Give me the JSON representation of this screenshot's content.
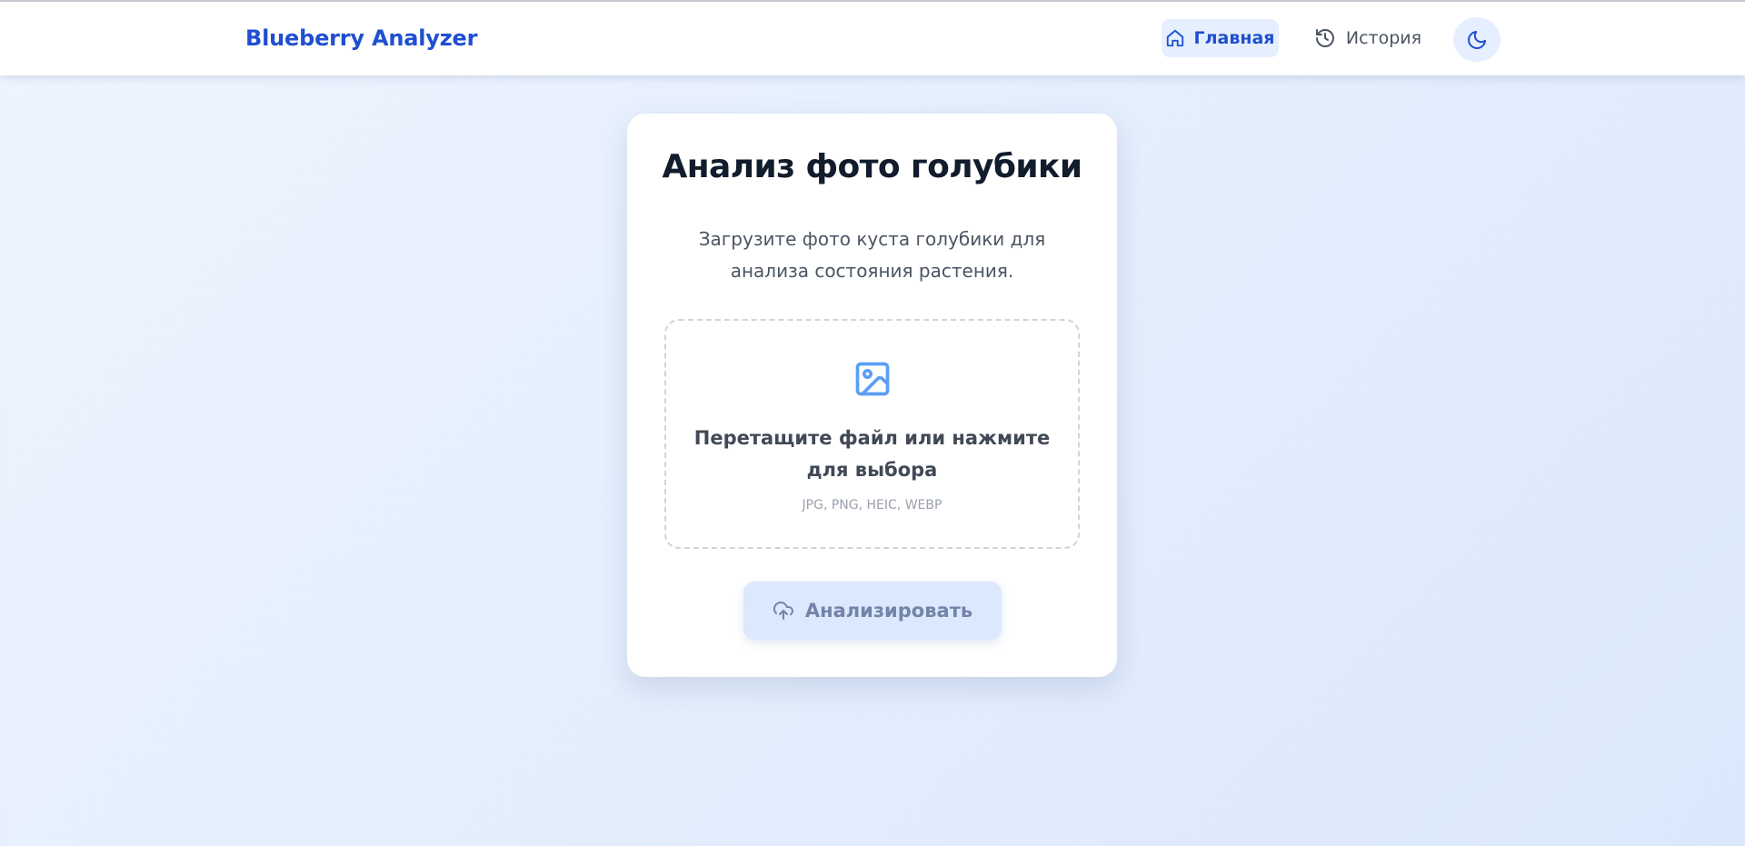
{
  "app": {
    "brand": "Blueberry Analyzer"
  },
  "nav": {
    "home_label": "Главная",
    "history_label": "История",
    "home_icon": "home-icon",
    "history_icon": "history-icon",
    "theme_icon": "moon-icon"
  },
  "card": {
    "title": "Анализ фото голубики",
    "subtitle": "Загрузите фото куста голубики для анализа состояния растения."
  },
  "dropzone": {
    "icon": "image-icon",
    "title": "Перетащите файл или нажмите для выбора",
    "formats": "JPG, PNG, HEIC, WEBP"
  },
  "action": {
    "analyze_label": "Анализировать",
    "icon": "cloud-upload-icon"
  },
  "colors": {
    "accent": "#1f4fd0",
    "accent_light": "#e6efff",
    "title": "#111c2d",
    "disabled_button_bg": "#dce8fd",
    "disabled_button_text": "#7384a8"
  }
}
